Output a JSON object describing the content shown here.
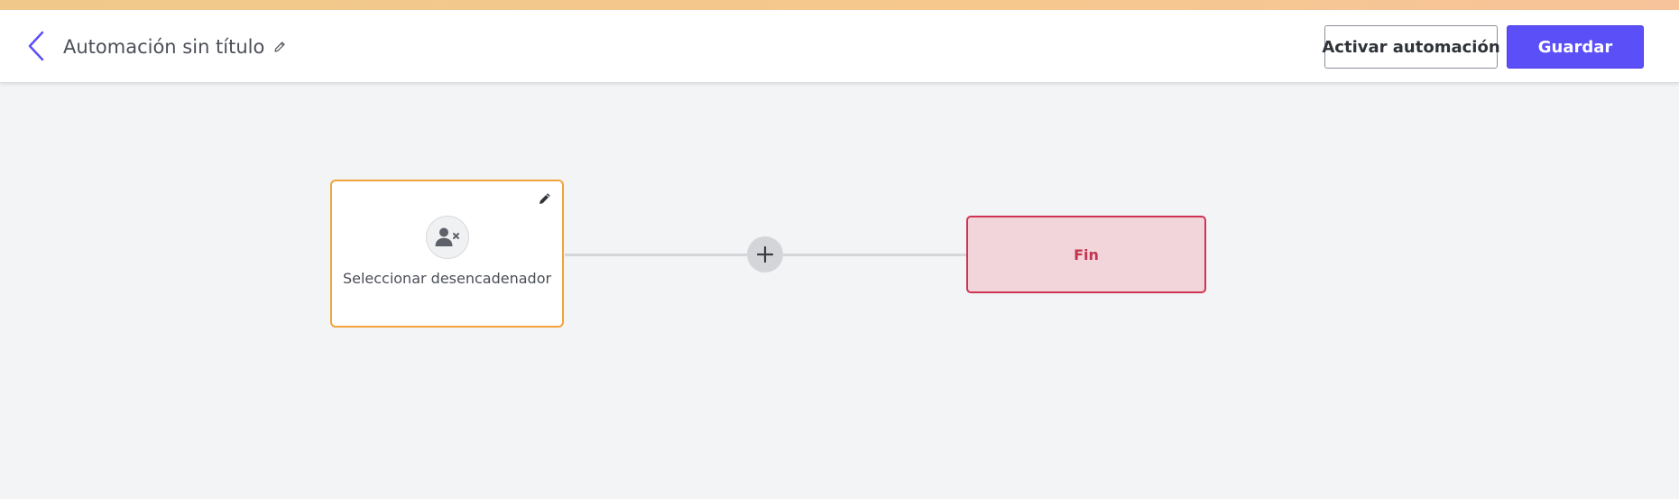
{
  "header": {
    "title": "Automación sin título",
    "activate_label": "Activar automación",
    "save_label": "Guardar"
  },
  "icons": {
    "back": "chevron-left-icon",
    "title_edit": "pencil-icon",
    "trigger_edit": "pencil-icon",
    "trigger": "user-remove-icon",
    "add": "plus-icon"
  },
  "colors": {
    "accent": "#5b4ff7",
    "trigger_border": "#f2a33a",
    "end_border": "#cf3452",
    "end_fill": "#f2d5da"
  },
  "flow": {
    "trigger_label": "Seleccionar desencadenador",
    "end_label": "Fin"
  }
}
